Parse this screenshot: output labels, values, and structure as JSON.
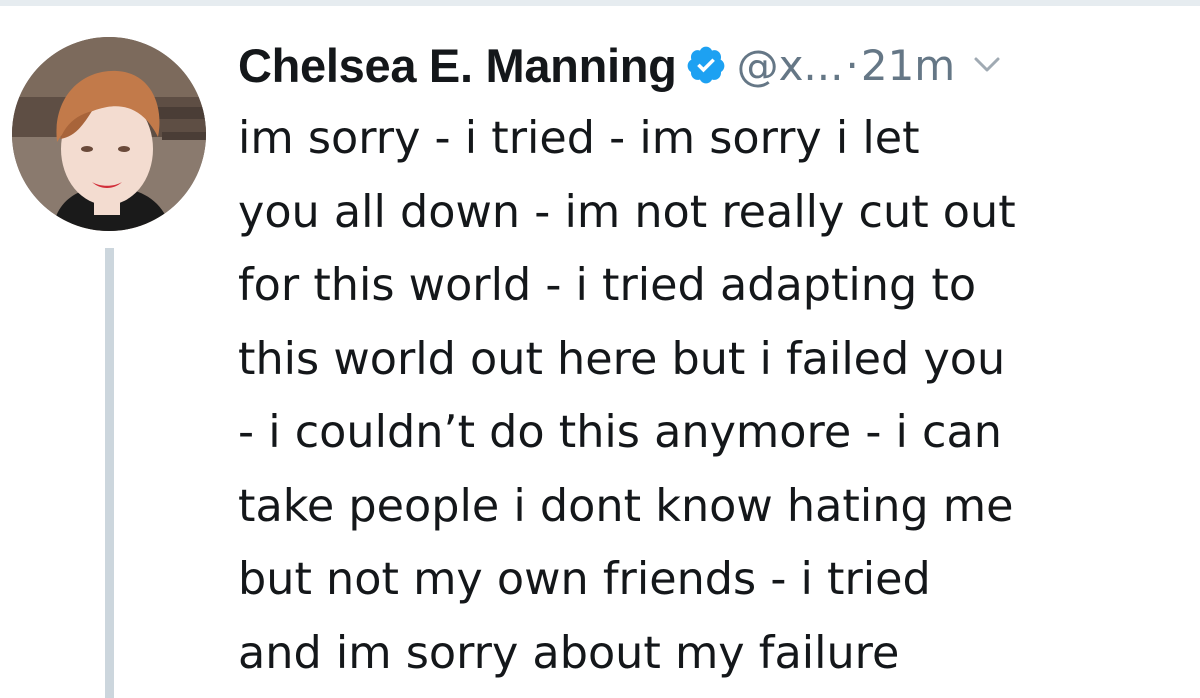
{
  "tweet": {
    "display_name": "Chelsea E. Manning",
    "handle": "@x...",
    "separator": "·",
    "time": "21m",
    "lines": [
      "im sorry - i tried - im sorry i let",
      "you all down - im not really cut out",
      "for this world - i tried adapting to",
      "this world out here but i failed you",
      "- i couldn’t do this anymore - i can",
      "take people i dont know hating me",
      "but not my own friends - i tried",
      "and im sorry about my failure"
    ]
  },
  "icons": {
    "verified": "verified-badge-icon",
    "caret": "chevron-down-icon",
    "avatar": "profile-photo"
  },
  "colors": {
    "verified_blue": "#1da1f2",
    "secondary_text": "#657786",
    "primary_text": "#14171a",
    "thread_line": "#ccd6dd"
  }
}
